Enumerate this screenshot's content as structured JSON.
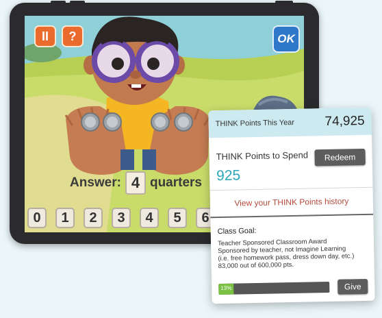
{
  "game": {
    "pause_label": "II",
    "help_label": "?",
    "ok_label": "OK",
    "answer_prefix": "Answer:",
    "answer_value": "4",
    "answer_unit": "quarters",
    "numpad": [
      "0",
      "1",
      "2",
      "3",
      "4",
      "5",
      "6"
    ]
  },
  "think_points": {
    "year_label": "THINK Points This Year",
    "year_value": "74,925",
    "spend_label": "THINK Points to Spend",
    "spend_value": "925",
    "redeem_label": "Redeem",
    "history_link": "View your THINK Points history",
    "goal": {
      "title": "Class Goal:",
      "name": "Teacher Sponsored Classroom Award",
      "sponsor": "Sponsored by teacher, not Imagine Learning",
      "examples": "(i.e. free homework pass, dress down day, etc.)",
      "progress_text": "83,000 out of 600,000 pts.",
      "percent_label": "13%",
      "percent": 13.8,
      "give_label": "Give"
    }
  },
  "colors": {
    "accent_orange": "#ea6b2c",
    "ok_blue": "#2f78c9",
    "points_teal": "#2aa6b8",
    "progress_green": "#7ac143"
  }
}
